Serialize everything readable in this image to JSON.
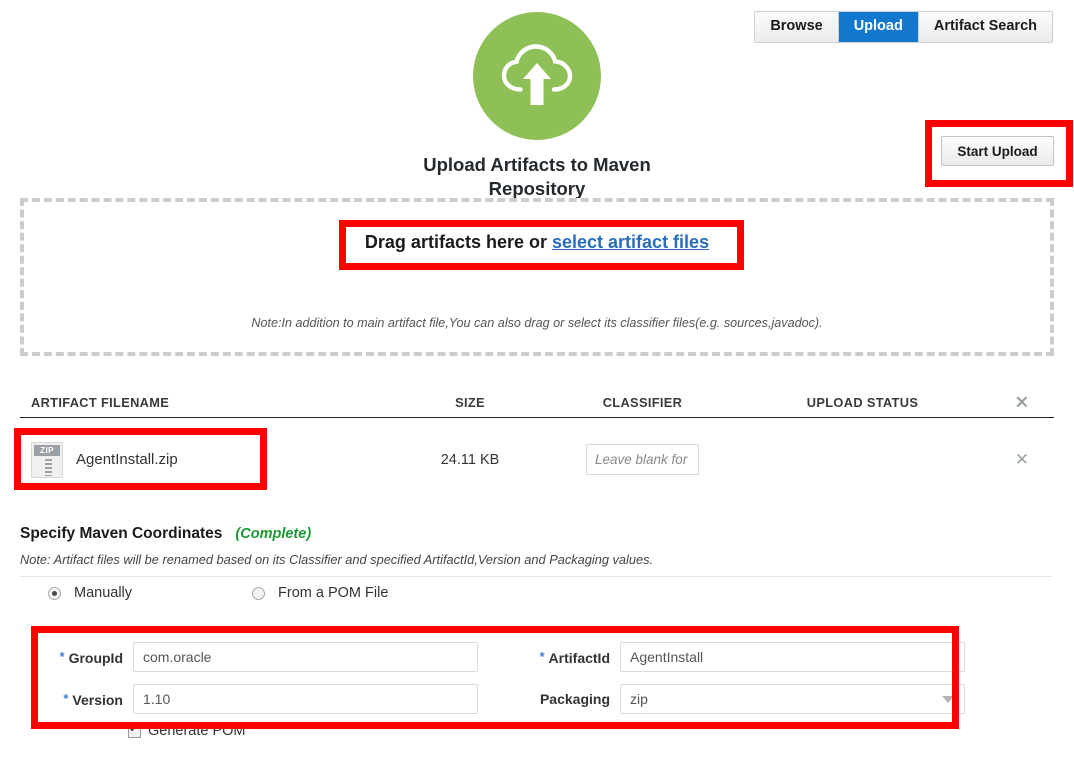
{
  "nav": {
    "tabs": [
      {
        "label": "Browse",
        "active": false
      },
      {
        "label": "Upload",
        "active": true
      },
      {
        "label": "Artifact Search",
        "active": false
      }
    ]
  },
  "hero": {
    "icon": "cloud-upload-icon",
    "title": "Upload Artifacts to Maven Repository",
    "circle_color": "#8fc057"
  },
  "actions": {
    "start_upload_label": "Start Upload"
  },
  "dropzone": {
    "prompt_prefix": "Drag artifacts here or ",
    "link_label": "select artifact files",
    "note": "Note:In addition to main artifact file,You can also drag or select its classifier files(e.g. sources,javadoc)."
  },
  "table": {
    "headers": {
      "filename": "ARTIFACT FILENAME",
      "size": "SIZE",
      "classifier": "CLASSIFIER",
      "status": "UPLOAD STATUS",
      "remove": "✕"
    },
    "rows": [
      {
        "file_icon_label": "ZIP",
        "filename": "AgentInstall.zip",
        "size": "24.11 KB",
        "classifier_value": "",
        "classifier_placeholder": "Leave blank for",
        "status": "",
        "remove": "✕"
      }
    ]
  },
  "coordinates": {
    "title": "Specify Maven Coordinates",
    "status": "(Complete)",
    "status_color": "#1a9a33",
    "note": "Note: Artifact files will be renamed based on its Classifier and specified ArtifactId,Version and Packaging values.",
    "mode_options": [
      {
        "label": "Manually",
        "selected": true
      },
      {
        "label": "From a POM File",
        "selected": false
      }
    ],
    "fields": {
      "group_id": {
        "label": "GroupId",
        "required": true,
        "value": "com.oracle"
      },
      "artifact_id": {
        "label": "ArtifactId",
        "required": true,
        "value": "AgentInstall"
      },
      "version": {
        "label": "Version",
        "required": true,
        "value": "1.10"
      },
      "packaging": {
        "label": "Packaging",
        "required": false,
        "value": "zip"
      }
    },
    "generate_pom": {
      "label": "Generate POM",
      "checked": true
    }
  },
  "annotations": {
    "color": "#ff0000",
    "boxes": [
      "start-upload-button",
      "drag-drop-prompt",
      "artifact-file-row",
      "maven-coordinates-fields"
    ]
  }
}
